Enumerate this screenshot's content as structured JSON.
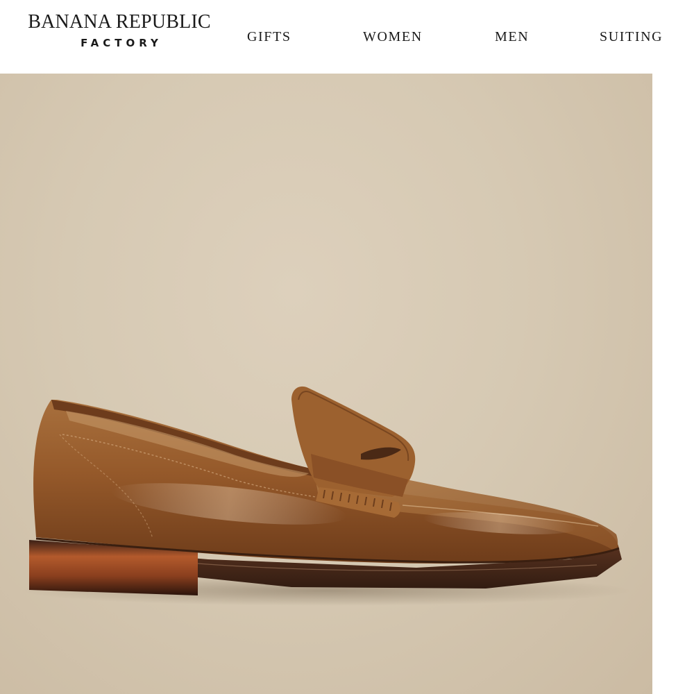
{
  "brand": {
    "name": "BANANA REPUBLIC",
    "sub": "FACTORY"
  },
  "nav": {
    "items": [
      {
        "label": "GIFTS"
      },
      {
        "label": "WOMEN"
      },
      {
        "label": "MEN"
      },
      {
        "label": "SUITING"
      }
    ]
  },
  "hero": {
    "image": "brown-leather-penny-loafer",
    "colors": {
      "background": "#d6c9b3",
      "leather": "#9a5f2e",
      "sole": "#4a2a18",
      "heel_accent": "#a14f2a"
    }
  }
}
